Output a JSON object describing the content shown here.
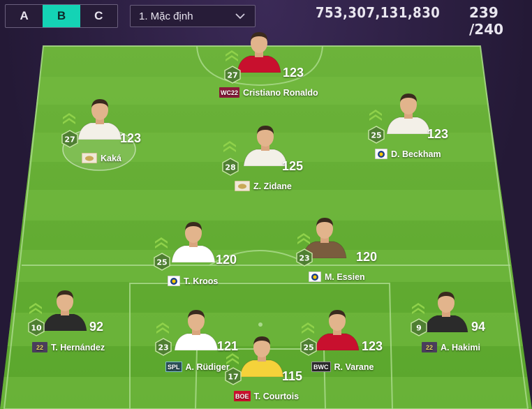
{
  "tabs": [
    "A",
    "B",
    "C"
  ],
  "active_tab": "B",
  "formation_dropdown": {
    "value": "1. Mặc định"
  },
  "budget": "753,307,131,830",
  "player_count": "239 /240",
  "players": [
    {
      "id": "ronaldo",
      "name": "Cristiano Ronaldo",
      "ovr": "123",
      "level": "27",
      "badge": "WC22",
      "badge_type": "wc",
      "shirt": "#c8102e"
    },
    {
      "id": "kaka",
      "name": "Kaká",
      "ovr": "123",
      "level": "27",
      "badge": "",
      "badge_type": "icon",
      "shirt": "#f3f0e8"
    },
    {
      "id": "beckham",
      "name": "D. Beckham",
      "ovr": "123",
      "level": "25",
      "badge": "",
      "badge_type": "club",
      "shirt": "#f3f0e8"
    },
    {
      "id": "zidane",
      "name": "Z. Zidane",
      "ovr": "125",
      "level": "28",
      "badge": "",
      "badge_type": "icon",
      "shirt": "#f3f0e8"
    },
    {
      "id": "kroos",
      "name": "T. Kroos",
      "ovr": "120",
      "level": "25",
      "badge": "",
      "badge_type": "club",
      "shirt": "#ffffff"
    },
    {
      "id": "essien",
      "name": "M. Essien",
      "ovr": "120",
      "level": "23",
      "badge": "",
      "badge_type": "club",
      "shirt": "#7a5c3e"
    },
    {
      "id": "hernandez",
      "name": "T. Hernández",
      "ovr": "92",
      "level": "10",
      "badge": "22",
      "badge_type": "22",
      "shirt": "#2b2b2b"
    },
    {
      "id": "rudiger",
      "name": "A. Rüdiger",
      "ovr": "121",
      "level": "23",
      "badge": "SPL",
      "badge_type": "spl",
      "shirt": "#ffffff"
    },
    {
      "id": "varane",
      "name": "R. Varane",
      "ovr": "123",
      "level": "25",
      "badge": "BWC",
      "badge_type": "bwc",
      "shirt": "#c8102e"
    },
    {
      "id": "hakimi",
      "name": "A. Hakimi",
      "ovr": "94",
      "level": "9",
      "badge": "22",
      "badge_type": "22",
      "shirt": "#2b2b2b"
    },
    {
      "id": "courtois",
      "name": "T. Courtois",
      "ovr": "115",
      "level": "17",
      "badge": "BOE",
      "badge_type": "boe",
      "shirt": "#f5d23a"
    }
  ]
}
